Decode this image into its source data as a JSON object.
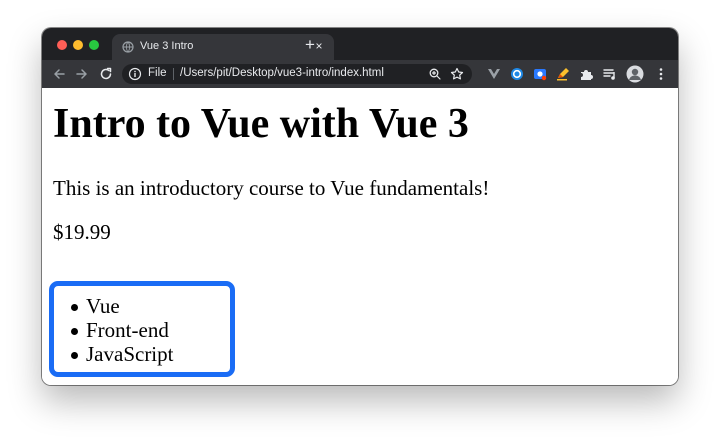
{
  "window": {
    "controls": {
      "close": "close",
      "minimize": "minimize",
      "maximize": "maximize"
    }
  },
  "tab": {
    "title": "Vue 3 Intro",
    "close_label": "×",
    "new_tab_label": "+"
  },
  "toolbar": {
    "url_scheme": "File",
    "url": "/Users/pit/Desktop/vue3-intro/index.html"
  },
  "page": {
    "heading": "Intro to Vue with Vue 3",
    "description": "This is an introductory course to Vue fundamentals!",
    "price": "$19.99",
    "details": [
      "Vue",
      "Front-end",
      "JavaScript"
    ]
  },
  "colors": {
    "titlebar": "#202124",
    "toolbar": "#35363a",
    "highlight_border": "#1a6cf5"
  }
}
